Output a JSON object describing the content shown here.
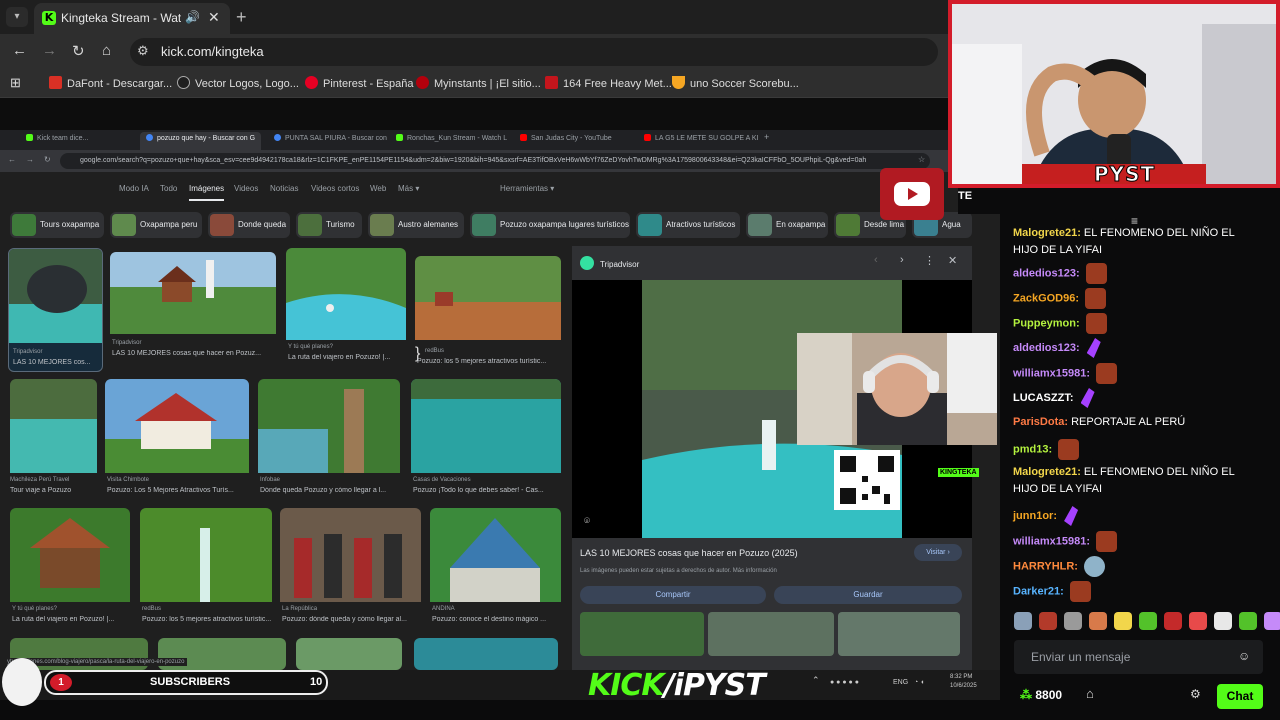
{
  "browser": {
    "tab_title": "Kingteka Stream - Watch Li",
    "url": "kick.com/kingteka",
    "bookmarks": [
      "DaFont - Descargar...",
      "Vector Logos, Logo...",
      "Pinterest - España",
      "Myinstants | ¡El sitio...",
      "164 Free Heavy Met...",
      "uno Soccer Scorebu..."
    ]
  },
  "inner_browser": {
    "tabs": [
      "Kick team dice...",
      "pozuzo que hay - Buscar con G",
      "PUNTA SAL PIURA - Buscar con",
      "Ronchas_Kun Stream - Watch L",
      "San Judas City - YouTube",
      "LA G5 LE METE SU GOLPE A KI"
    ],
    "url": "google.com/search?q=pozuzo+que+hay&sca_esv=cee9d4942178ca18&rlz=1C1FKPE_enPE1154PE1154&udm=2&biw=1920&bih=945&sxsrf=AE3TifOBxVeH6wWbYf76ZeDYovhTwDMRg%3A1759800643348&ei=Q23kaICFFbO_5OUPhpiL-Qg&ved=0ah",
    "filters": [
      "Modo IA",
      "Todo",
      "Imágenes",
      "Videos",
      "Noticias",
      "Videos cortos",
      "Web",
      "Más ▾",
      "Herramientas ▾"
    ],
    "chips": [
      "Tours oxapampa",
      "Oxapampa peru",
      "Donde queda",
      "Turismo",
      "Austro alemanes",
      "Pozuzo oxapampa lugares turísticos",
      "Atractivos turísticos",
      "En oxapampa",
      "Desde lima",
      "Agua"
    ],
    "results": [
      {
        "src": "Tripadvisor",
        "title": "LAS 10 MEJORES cos..."
      },
      {
        "src": "Tripadvisor",
        "title": "LAS 10 MEJORES cosas que hacer en Pozuz..."
      },
      {
        "src": "Y tú qué planes?",
        "title": "La ruta del viajero en Pozuzo! |..."
      },
      {
        "src": "redBus",
        "title": "Pozuzo: los 5 mejores atractivos turístic..."
      },
      {
        "src": "Machileza Perú Travel",
        "title": "Tour viaje a Pozuzo"
      },
      {
        "src": "Visita Chimbote",
        "title": "Pozuzo: Los 5 Mejores Atractivos Turís..."
      },
      {
        "src": "Infobae",
        "title": "Dónde queda Pozuzo y cómo llegar a l..."
      },
      {
        "src": "Casas de Vacaciones",
        "title": "Pozuzo ¡Todo lo que debes saber! - Cas..."
      },
      {
        "src": "Y tú qué planes?",
        "title": "La ruta del viajero en Pozuzo! |..."
      },
      {
        "src": "redBus",
        "title": "Pozuzo: los 5 mejores atractivos turístic..."
      },
      {
        "src": "La República",
        "title": "Pozuzo: dónde queda y cómo llegar al..."
      },
      {
        "src": "ANDINA",
        "title": "Pozuzo: conoce el destino mágico ..."
      }
    ],
    "panel": {
      "source": "Tripadvisor",
      "title": "LAS 10 MEJORES cosas que hacer en Pozuzo (2025)",
      "note": "Las imágenes pueden estar sujetas a derechos de autor. Más información",
      "visit": "Visitar ›",
      "share": "Compartir",
      "save": "Guardar"
    },
    "status_url": "ytuqueplanes.com/blog-viajero/pasca/la-ruta-del-viajero-en-pozuzo",
    "tray_lang": "ENG",
    "time": "8:32 PM",
    "date": "10/6/2025",
    "qr_label": "KINGTEKA"
  },
  "overlay": {
    "cam_brand": "PYST",
    "cam_caption": "TE",
    "subscribers_label": "SUBSCRIBERS",
    "subscribers_count": "10",
    "sub_badge": "1",
    "brand_left": "KICK",
    "brand_right": "iPYST"
  },
  "chat": {
    "messages": [
      {
        "user": "Malogrete21",
        "color": "#f2d64b",
        "text": "EL FENOMENO DEL NIÑO EL",
        "emote": ""
      },
      {
        "user": "",
        "color": "#ffffff",
        "text": "HIJO DE LA YIFAI",
        "emote": ""
      },
      {
        "user": "aldedios123",
        "color": "#c58af9",
        "text": "",
        "emote": "face"
      },
      {
        "user": "ZackGOD96",
        "color": "#f5a623",
        "text": "",
        "emote": "face"
      },
      {
        "user": "Puppeymon",
        "color": "#b4f23f",
        "text": "",
        "emote": "face"
      },
      {
        "user": "aldedios123",
        "color": "#c58af9",
        "text": "",
        "emote": "purple"
      },
      {
        "user": "williamx15981",
        "color": "#c58af9",
        "text": "",
        "emote": "face"
      },
      {
        "user": "LUCASZZT",
        "color": "#ffffff",
        "text": "",
        "emote": "purple"
      },
      {
        "user": "ParisDota",
        "color": "#ff7a45",
        "text": "REPORTAJE AL PERÚ",
        "emote": ""
      },
      {
        "user": "pmd13",
        "color": "#b4f23f",
        "text": "",
        "emote": "face"
      },
      {
        "user": "Malogrete21",
        "color": "#f2d64b",
        "text": "EL FENOMENO DEL NIÑO EL",
        "emote": ""
      },
      {
        "user": "",
        "color": "#ffffff",
        "text": "HIJO DE LA YIFAI",
        "emote": ""
      },
      {
        "user": "junn1or",
        "color": "#f5a623",
        "text": "",
        "emote": "purple"
      },
      {
        "user": "williamx15981",
        "color": "#c58af9",
        "text": "",
        "emote": "face"
      },
      {
        "user": "HARRYHLR",
        "color": "#ff8a3d",
        "text": "",
        "emote": "bird"
      },
      {
        "user": "Darker21",
        "color": "#58b4ff",
        "text": "",
        "emote": "face"
      }
    ],
    "input_placeholder": "Enviar un mensaje",
    "points": "8800",
    "send_label": "Chat"
  },
  "colors": {
    "kick_green": "#53fc18",
    "cam_border": "#d31c2a"
  }
}
